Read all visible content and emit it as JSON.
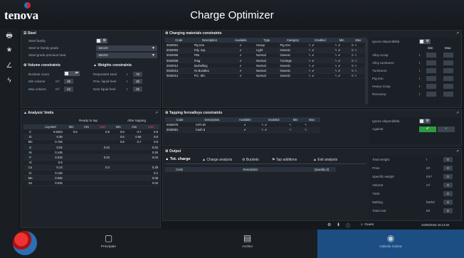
{
  "app": {
    "brand": "tenova",
    "title": "Charge Optimizer"
  },
  "nav_icons": [
    "🖶",
    "★",
    "∠",
    "ϟ"
  ],
  "steel": {
    "title": "Steel",
    "family_label": "Steel family",
    "grade_label": "Steel or family grade",
    "grade_value": "16AJO",
    "prev_heat_label": "Steel grade previous heat",
    "prev_heat_value": "16AXA"
  },
  "volume": {
    "title": "Volume constraints",
    "buckets_label": "Buckets count",
    "min_label": "Min volume",
    "max_label": "Max volume",
    "unit": "m³",
    "min_value": "29",
    "max_value": "43"
  },
  "weights": {
    "title": "Weights constraints",
    "req_label": "Requested steel",
    "prev_label": "Prev. liquid heel",
    "next_label": "Next liquid heel",
    "unit": "t",
    "req_value": "78",
    "prev_value": "25",
    "next_value": "25"
  },
  "analysis": {
    "title": "Analysis' limits",
    "group1": "Ready to tap",
    "group2": "After tapping",
    "headers": [
      "",
      "Liq.Heel",
      "Min",
      "Aim",
      "Max",
      "Min",
      "Aim",
      "Max"
    ],
    "rows": [
      [
        "C",
        "0.5023",
        "0.5",
        "",
        "0.8",
        "0.6",
        "0.7",
        "0.8"
      ],
      [
        "Si",
        "0.36",
        "",
        "",
        "",
        "0.5",
        "0.55",
        "0.6"
      ],
      [
        "Mn",
        "0.745",
        "",
        "",
        "",
        "0.6",
        "0.7",
        "0.8"
      ],
      [
        "S",
        "0.02",
        "",
        "",
        "0.02",
        "",
        "",
        "0.04"
      ],
      [
        "Ni",
        "0.145",
        "",
        "",
        "",
        "",
        "",
        "0.25"
      ],
      [
        "P",
        "0.015",
        "",
        "",
        "0.02",
        "",
        "",
        "0.04"
      ],
      [
        "Al",
        "0.5",
        "",
        "",
        "",
        "",
        "",
        ""
      ],
      [
        "Cu",
        "0.14",
        "",
        "",
        "0.2",
        "",
        "",
        "0.28"
      ],
      [
        "Cr",
        "0.145",
        "",
        "",
        "",
        "",
        "",
        "0.2"
      ],
      [
        "Mo",
        "0.045",
        "",
        "",
        "",
        "",
        "",
        "0.06"
      ],
      [
        "Sn",
        "0.015",
        "",
        "",
        "",
        "",
        "",
        "0.03"
      ]
    ]
  },
  "charging": {
    "title": "Charging materials constraints",
    "headers": [
      "Code",
      "Description",
      "Available",
      "Type",
      "Category",
      "Enabled",
      "Min",
      "Max"
    ],
    "rows": [
      [
        "0020001",
        "Pig Iron",
        "✔",
        "Heavy",
        "Pig Iron"
      ],
      [
        "0020003",
        "Fdy. scp.",
        "✔",
        "Light",
        "Generic"
      ],
      [
        "0020005",
        "F85",
        "✔",
        "Normal",
        "Generic"
      ],
      [
        "0020006",
        "Frag",
        "✔",
        "Normal",
        "Turnings"
      ],
      [
        "0020012",
        "bushelling",
        "✔",
        "Normal",
        "Generic"
      ],
      [
        "0020013",
        "#1 Bundles",
        "✔",
        "Normal",
        "Generic"
      ],
      [
        "0020014",
        "P.C. Sth.",
        "✔",
        "Normal",
        "Generic"
      ]
    ],
    "side": {
      "ignore_label": "Ignore disponibilità",
      "min_label": "Min",
      "max_label": "Max",
      "items": [
        "Alloy scrap",
        "Alloy turnitures",
        "Turnitures",
        "Pig iron",
        "Heavy scrap",
        "Recovery"
      ]
    }
  },
  "ferroalloys": {
    "title": "Tapping ferroalloys constraints",
    "headers": [
      "Code",
      "Description",
      "Available",
      "Enabled",
      "Min",
      "Max"
    ],
    "rows": [
      [
        "0030075",
        "CrFt 40",
        "✔"
      ],
      [
        "0030081",
        "Cash 5",
        "✔"
      ]
    ],
    "side": {
      "ignore_label": "Ignore disponibilità",
      "against_label": "Against"
    }
  },
  "output": {
    "title": "Output",
    "tabs": [
      "Tot. charge",
      "Charge analysis",
      "Buckets",
      "Tap additions",
      "Exit analysis"
    ],
    "table_headers": [
      "Code",
      "Description",
      "Quantity (t)"
    ],
    "results": [
      {
        "label": "Total weight",
        "unit": "t",
        "value": "0"
      },
      {
        "label": "Price",
        "unit": "€/t",
        "value": "0"
      },
      {
        "label": "Specific weight",
        "unit": "t/m³",
        "value": "0"
      },
      {
        "label": "Volume",
        "unit": "m³",
        "value": "0"
      },
      {
        "label": "Yield",
        "unit": "",
        "value": "0"
      },
      {
        "label": "Melting",
        "unit": "kWh/t",
        "value": "0"
      },
      {
        "label": "Total cost",
        "unit": "€/t",
        "value": "0"
      }
    ]
  },
  "status": {
    "user": "Guest",
    "datetime": "24/05/2016 15:14:02"
  },
  "bottom_nav": [
    {
      "label": "Principale"
    },
    {
      "label": "Archivi"
    },
    {
      "label": "Calcolo Carica"
    }
  ],
  "colors": {
    "accent": "#1c4e84",
    "green": "#2e9a3f"
  }
}
